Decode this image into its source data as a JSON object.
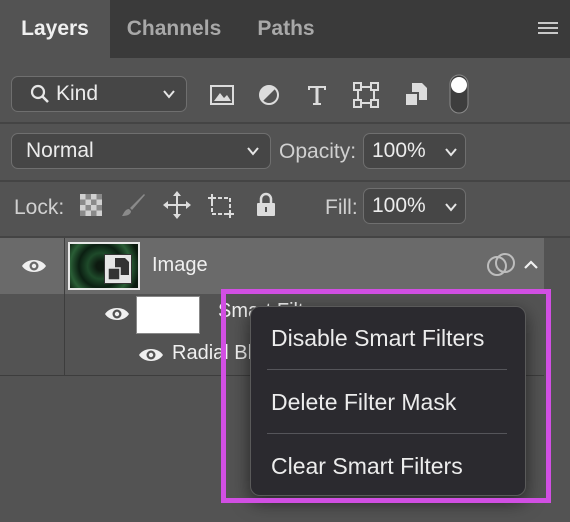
{
  "tabs": [
    {
      "label": "Layers",
      "active": true
    },
    {
      "label": "Channels",
      "active": false
    },
    {
      "label": "Paths",
      "active": false
    }
  ],
  "panel_menu_icon": "hamburger-icon",
  "filter": {
    "kind_label": "Kind",
    "icons": [
      "image-filter-icon",
      "adjustment-filter-icon",
      "type-filter-icon",
      "shape-filter-icon",
      "smart-object-filter-icon",
      "filter-toggle-icon"
    ]
  },
  "blend": {
    "mode": "Normal",
    "opacity_label": "Opacity:",
    "opacity_value": "100%"
  },
  "lock": {
    "label": "Lock:",
    "icons": [
      "lock-transparent-icon",
      "lock-pixels-icon",
      "lock-position-icon",
      "lock-artboard-icon",
      "lock-all-icon"
    ],
    "fill_label": "Fill:",
    "fill_value": "100%"
  },
  "layers": {
    "layer_name": "Image",
    "smart_filters_label": "Smart Filters",
    "filter_name": "Radial Blur"
  },
  "context_menu": {
    "items": [
      "Disable Smart Filters",
      "Delete Filter Mask",
      "Clear Smart Filters"
    ]
  },
  "colors": {
    "panel_bg": "#535353",
    "tab_bg": "#3a3a3a",
    "selected_layer": "#6a6a6a",
    "menu_bg": "#2b2a2f",
    "highlight_border": "#d14fe3"
  }
}
